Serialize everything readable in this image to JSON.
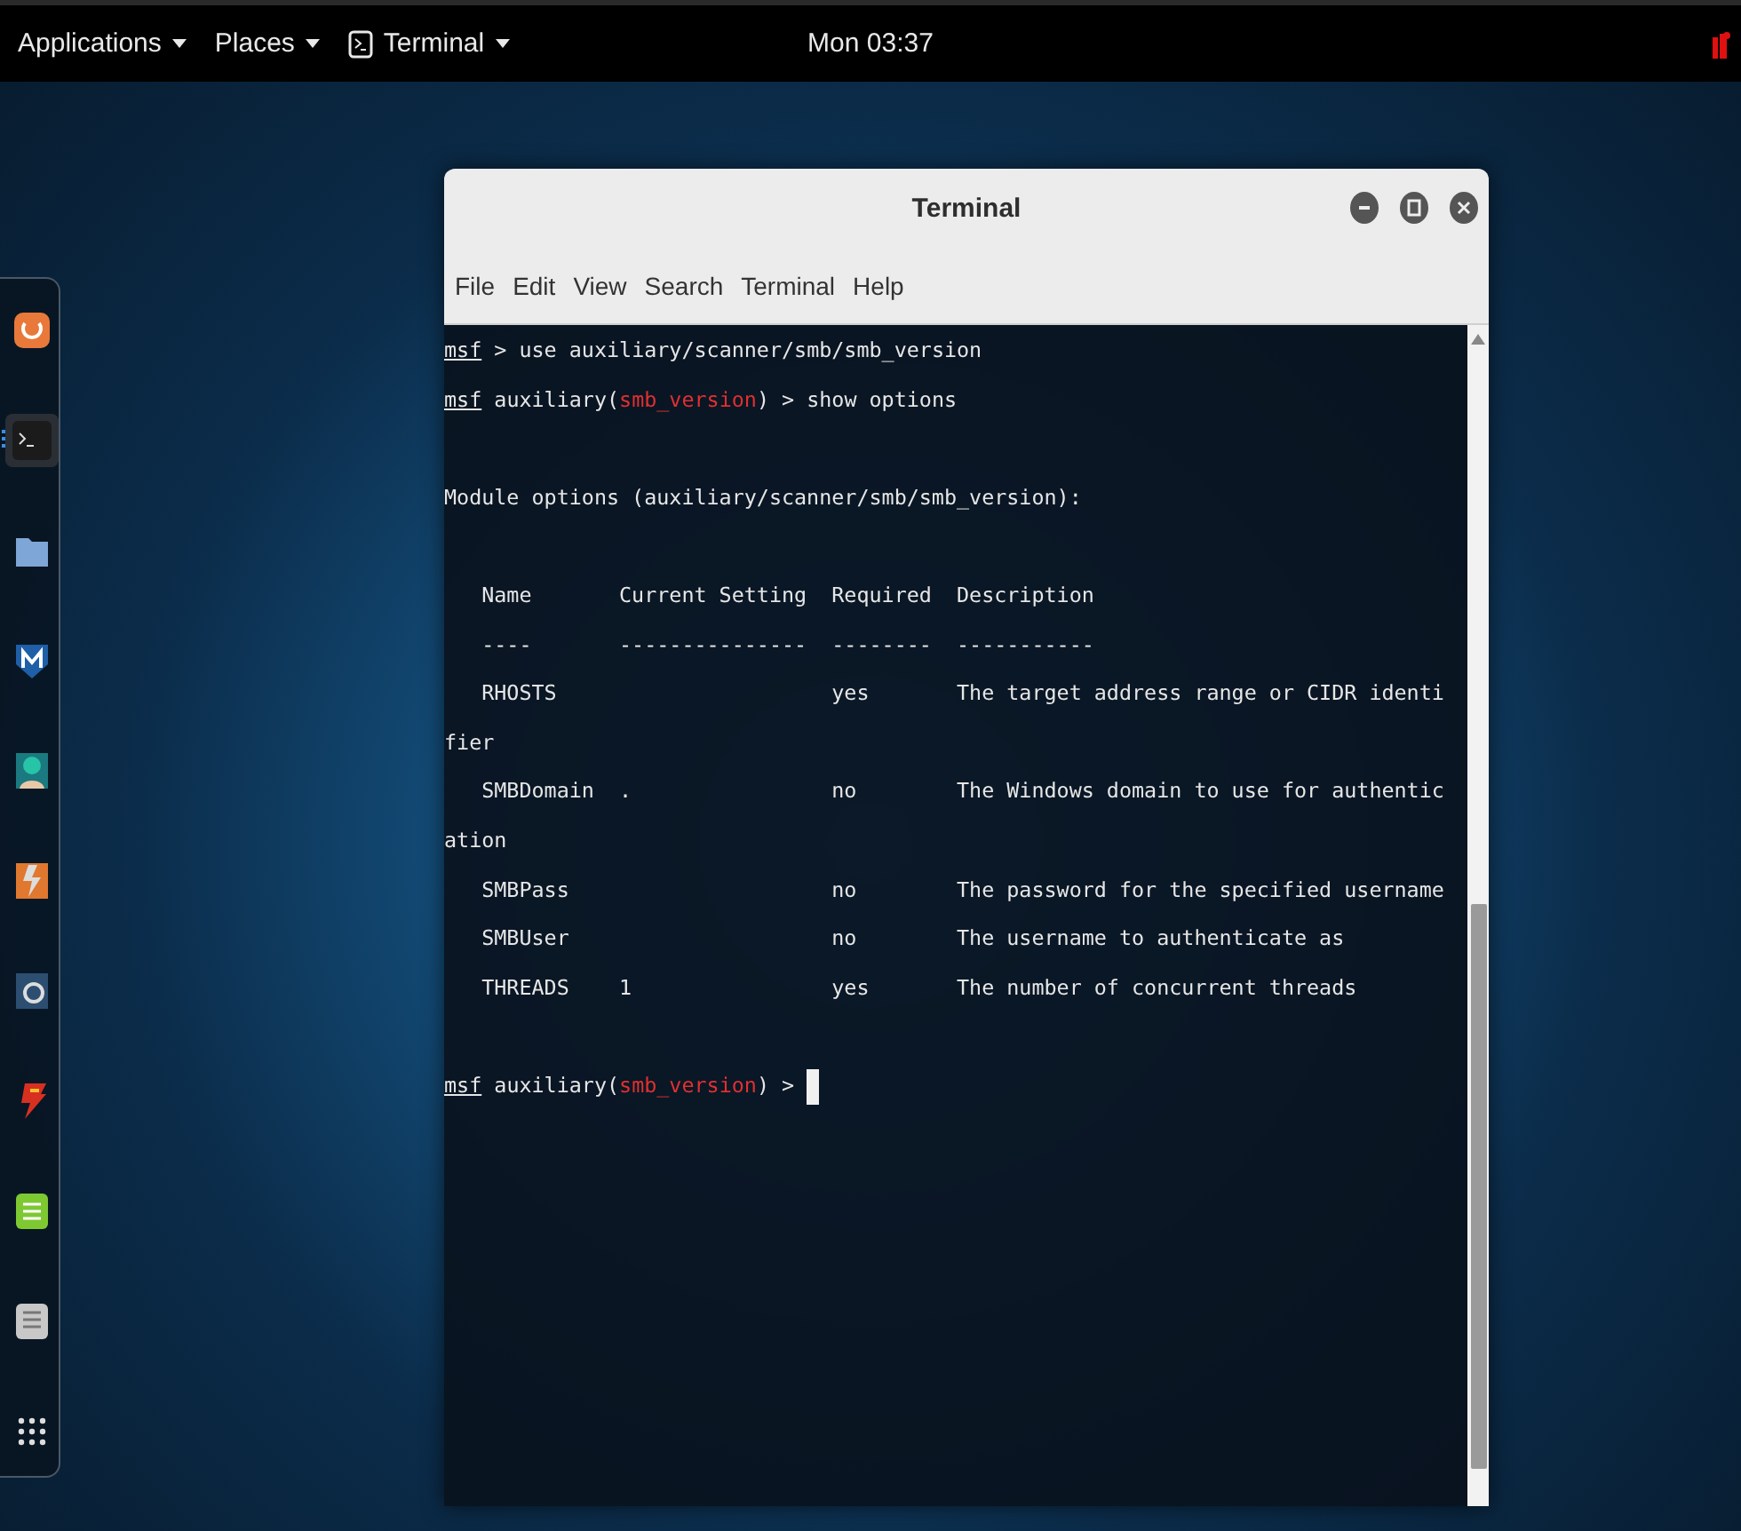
{
  "top_bar": {
    "menus": [
      {
        "label": "Applications",
        "kind": "plain"
      },
      {
        "label": "Places",
        "kind": "plain"
      },
      {
        "label": "Terminal",
        "kind": "app"
      }
    ],
    "clock": "Mon 03:37"
  },
  "dock": {
    "items": [
      {
        "kind": "orange-app",
        "selected": false
      },
      {
        "kind": "terminal",
        "selected": true
      },
      {
        "kind": "folder",
        "selected": false
      },
      {
        "kind": "shield",
        "selected": false
      },
      {
        "kind": "figure",
        "selected": false
      },
      {
        "kind": "bolt",
        "selected": false
      },
      {
        "kind": "swirl",
        "selected": false
      },
      {
        "kind": "flash",
        "selected": false
      },
      {
        "kind": "notes",
        "selected": false
      },
      {
        "kind": "keypad",
        "selected": false
      },
      {
        "kind": "grid",
        "selected": false
      }
    ]
  },
  "window": {
    "title": "Terminal",
    "menu": [
      "File",
      "Edit",
      "View",
      "Search",
      "Terminal",
      "Help"
    ],
    "lines": [
      {
        "kind": "prompt",
        "segments": [
          {
            "text": "msf",
            "kind": "prompt-name"
          },
          {
            "text": " > use auxiliary/scanner/smb/smb_version",
            "kind": "text"
          }
        ],
        "cursor": false
      },
      {
        "kind": "prompt",
        "segments": [
          {
            "text": "msf",
            "kind": "prompt-name"
          },
          {
            "text": " auxiliary(",
            "kind": "text"
          },
          {
            "text": "smb_version",
            "kind": "module"
          },
          {
            "text": ") > show options",
            "kind": "text"
          }
        ],
        "cursor": false
      },
      {
        "kind": "blank"
      },
      {
        "kind": "text",
        "text": "Module options (auxiliary/scanner/smb/smb_version):"
      },
      {
        "kind": "blank"
      },
      {
        "kind": "text",
        "text": "   Name       Current Setting  Required  Description"
      },
      {
        "kind": "text",
        "text": "   ----       ---------------  --------  -----------"
      },
      {
        "kind": "text",
        "text": "   RHOSTS                      yes       The target address range or CIDR identi"
      },
      {
        "kind": "text",
        "text": "fier"
      },
      {
        "kind": "text",
        "text": "   SMBDomain  .                no        The Windows domain to use for authentic"
      },
      {
        "kind": "text",
        "text": "ation"
      },
      {
        "kind": "text",
        "text": "   SMBPass                     no        The password for the specified username"
      },
      {
        "kind": "text",
        "text": "   SMBUser                     no        The username to authenticate as"
      },
      {
        "kind": "text",
        "text": "   THREADS    1                yes       The number of concurrent threads"
      },
      {
        "kind": "blank"
      },
      {
        "kind": "prompt",
        "segments": [
          {
            "text": "msf",
            "kind": "prompt-name"
          },
          {
            "text": " auxiliary(",
            "kind": "text"
          },
          {
            "text": "smb_version",
            "kind": "module"
          },
          {
            "text": ") > ",
            "kind": "text"
          }
        ],
        "cursor": true
      }
    ]
  }
}
